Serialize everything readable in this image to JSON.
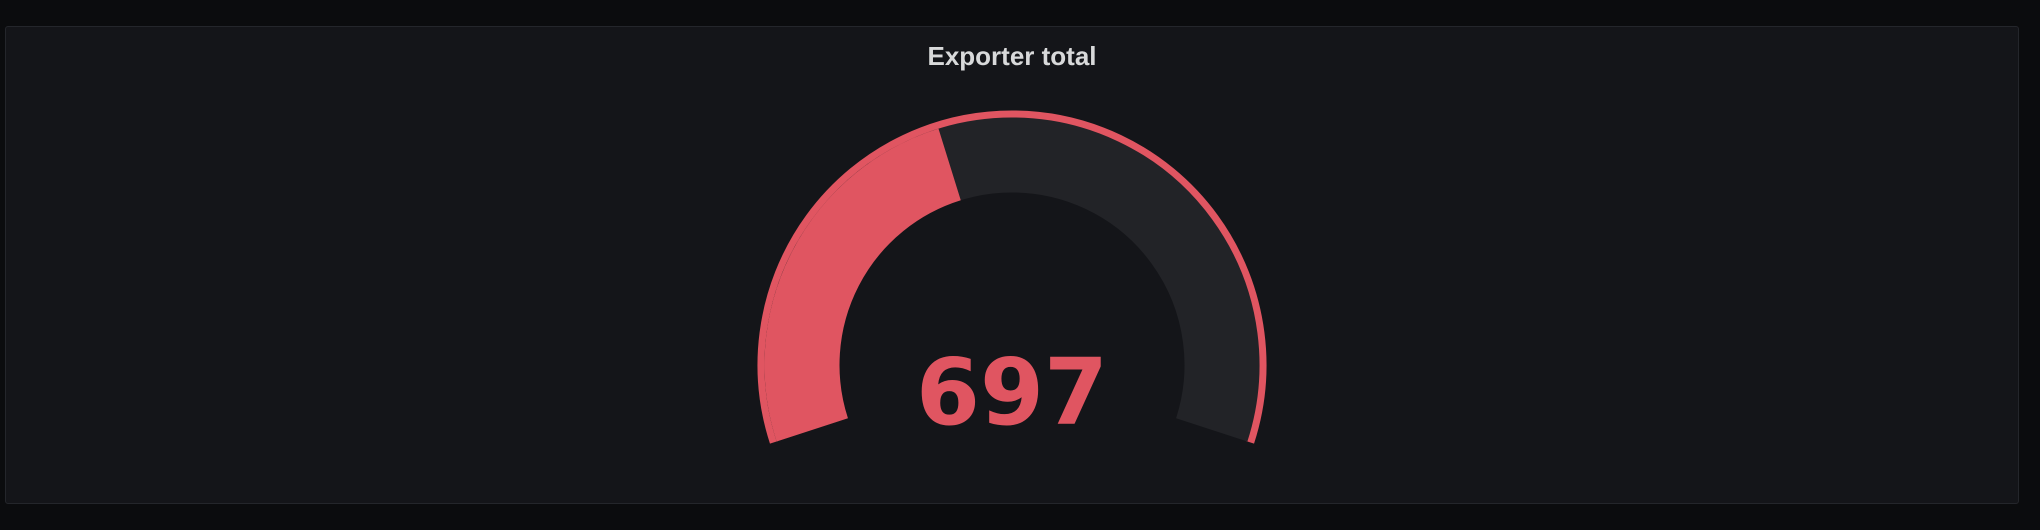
{
  "panel": {
    "title": "Exporter total"
  },
  "gauge": {
    "value": "697",
    "fill_fraction": 0.42,
    "color": "#e05561",
    "track_color": "#222327",
    "threshold_color": "#e05561"
  }
}
